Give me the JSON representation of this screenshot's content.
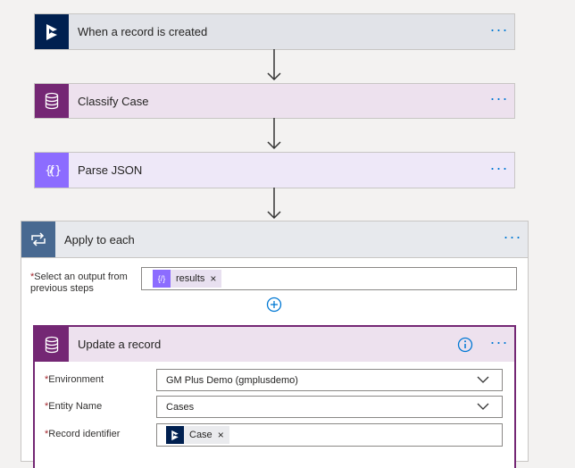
{
  "steps": [
    {
      "title": "When a record is created",
      "icon": "dynamics-icon",
      "color": "#002050",
      "bg": "#e1e3e8"
    },
    {
      "title": "Classify Case",
      "icon": "database-icon",
      "color": "#742774",
      "bg": "#ede1ee"
    },
    {
      "title": "Parse JSON",
      "icon": "json-icon",
      "color": "#8c6cff",
      "bg": "#eee8f8"
    }
  ],
  "more_label": "···",
  "loop": {
    "title": "Apply to each",
    "select_label": "Select an output from previous steps",
    "token_label": "results",
    "token_remove": "×"
  },
  "update": {
    "title": "Update a record",
    "fields": [
      {
        "label": "Environment",
        "value": "GM Plus Demo (gmplusdemo)"
      },
      {
        "label": "Entity Name",
        "value": "Cases"
      },
      {
        "label": "Record identifier",
        "token": "Case",
        "token_remove": "×"
      }
    ]
  },
  "required_mark": "*",
  "colors": {
    "accent": "#0078d4",
    "loop_header": "#e7e9ed",
    "update_border": "#742774"
  }
}
